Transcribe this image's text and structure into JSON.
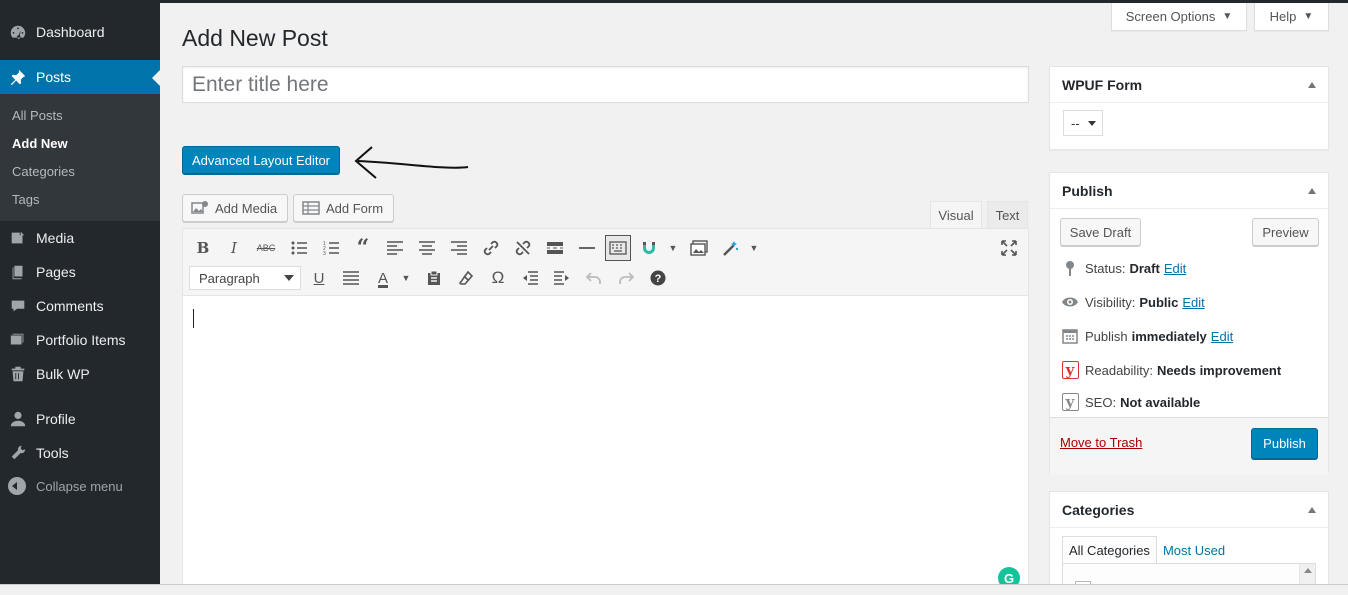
{
  "sidebar": {
    "items": [
      {
        "label": "Dashboard",
        "icon": "dashboard-icon"
      },
      {
        "label": "Posts",
        "icon": "pin-icon"
      },
      {
        "label": "Media",
        "icon": "media-icon"
      },
      {
        "label": "Pages",
        "icon": "pages-icon"
      },
      {
        "label": "Comments",
        "icon": "comments-icon"
      },
      {
        "label": "Portfolio Items",
        "icon": "portfolio-icon"
      },
      {
        "label": "Bulk WP",
        "icon": "trash-icon"
      },
      {
        "label": "Profile",
        "icon": "user-icon"
      },
      {
        "label": "Tools",
        "icon": "wrench-icon"
      }
    ],
    "submenu": [
      "All Posts",
      "Add New",
      "Categories",
      "Tags"
    ],
    "collapse_label": "Collapse menu"
  },
  "header": {
    "screen_options": "Screen Options",
    "help": "Help",
    "page_title": "Add New Post"
  },
  "editor": {
    "title_placeholder": "Enter title here",
    "advanced_layout_button": "Advanced Layout Editor",
    "add_media": "Add Media",
    "add_form": "Add Form",
    "tab_visual": "Visual",
    "tab_text": "Text",
    "format_value": "Paragraph",
    "grammarly_glyph": "G"
  },
  "wpuf_panel": {
    "title": "WPUF Form",
    "select_value": "--"
  },
  "publish_panel": {
    "title": "Publish",
    "save_draft": "Save Draft",
    "preview": "Preview",
    "status_label": "Status:",
    "status_value": "Draft",
    "visibility_label": "Visibility:",
    "visibility_value": "Public",
    "publish_label": "Publish",
    "publish_value": "immediately",
    "edit_link": "Edit",
    "readability_label": "Readability:",
    "readability_value": "Needs improvement",
    "seo_label": "SEO:",
    "seo_value": "Not available",
    "move_to_trash": "Move to Trash",
    "publish_button": "Publish",
    "yoast_glyph": "y"
  },
  "categories_panel": {
    "title": "Categories",
    "tab_all": "All Categories",
    "tab_most_used": "Most Used"
  },
  "colors": {
    "sidebar_bg": "#23282d",
    "accent": "#0073aa",
    "primary_button": "#0085ba",
    "trash_red": "#a00",
    "yoast_red": "#dc3232"
  }
}
